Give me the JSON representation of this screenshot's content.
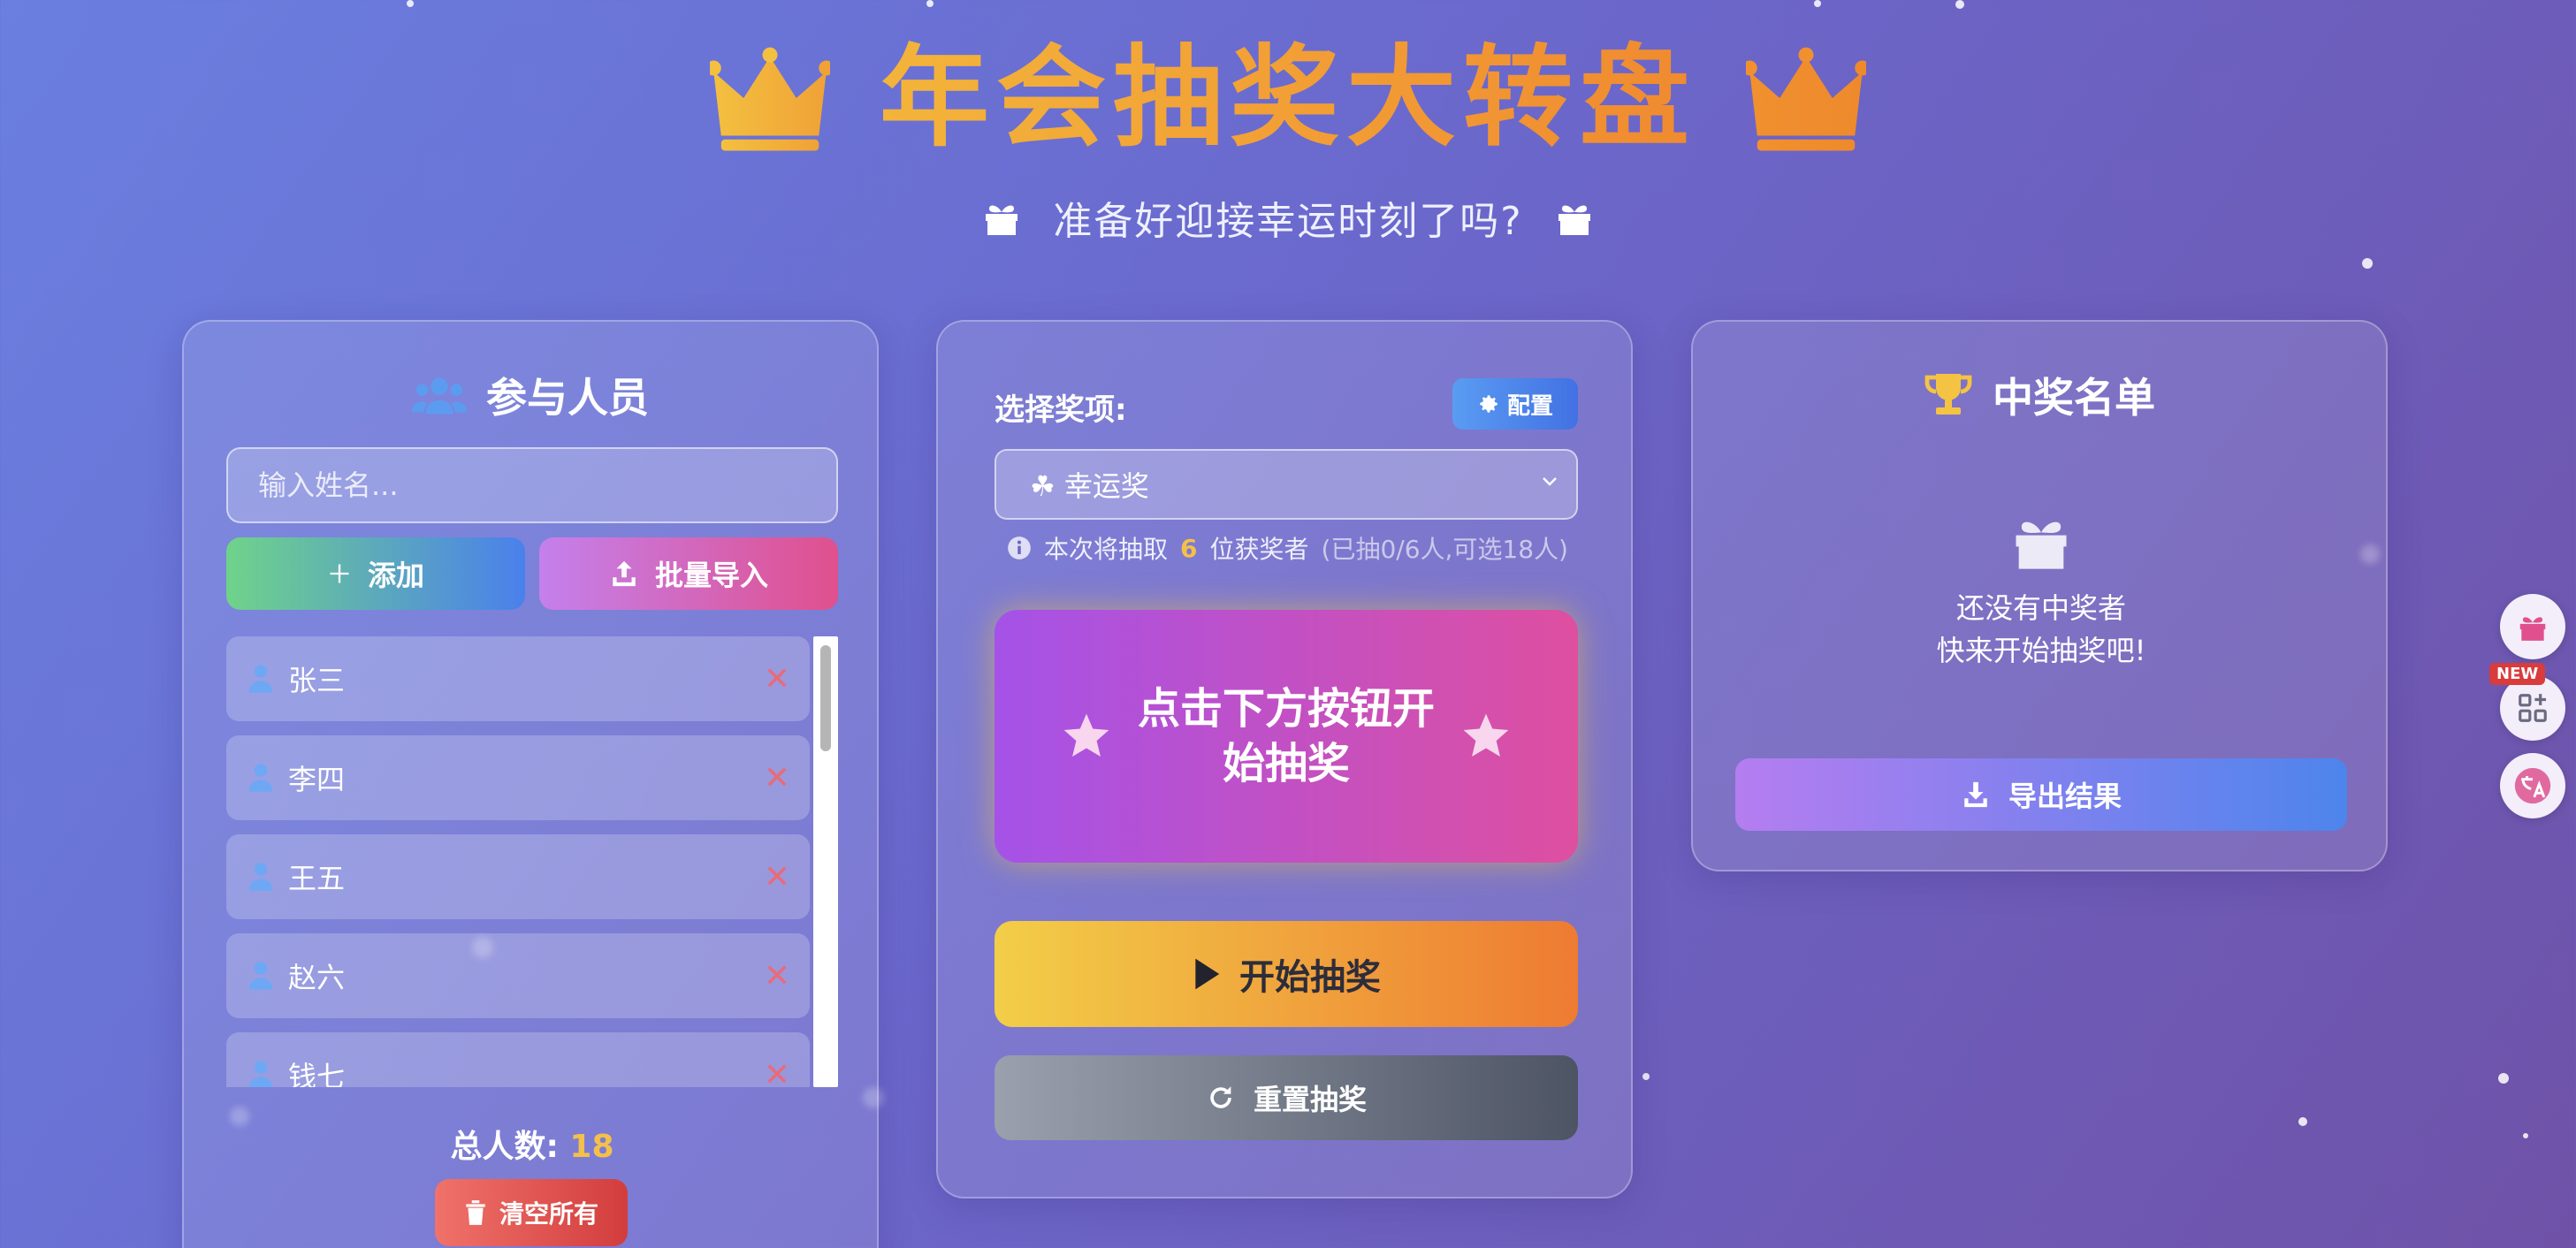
{
  "header": {
    "title": "年会抽奖大转盘",
    "subtitle": "准备好迎接幸运时刻了吗?"
  },
  "participants": {
    "title": "参与人员",
    "input_placeholder": "输入姓名...",
    "add_label": "添加",
    "import_label": "批量导入",
    "people": [
      "张三",
      "李四",
      "王五",
      "赵六",
      "钱七"
    ],
    "total_label": "总人数:",
    "total_count": "18",
    "clear_label": "清空所有"
  },
  "draw": {
    "prize_label": "选择奖项:",
    "config_label": "配置",
    "selected_prize": "☘ 幸运奖",
    "info_prefix": "本次将抽取",
    "info_count": "6",
    "info_suffix": "位获奖者",
    "info_sub": "(已抽0/6人,可选18人)",
    "result_text": "点击下方按钮开始抽奖",
    "start_label": "开始抽奖",
    "reset_label": "重置抽奖"
  },
  "winners": {
    "title": "中奖名单",
    "empty_line1": "还没有中奖者",
    "empty_line2": "快来开始抽奖吧!",
    "export_label": "导出结果"
  },
  "side": {
    "new_badge": "NEW"
  },
  "colors": {
    "accent_gold": "#f3b43b",
    "accent_orange": "#f08a30",
    "danger": "#d23d3d",
    "primary_blue": "#4a80ec"
  }
}
